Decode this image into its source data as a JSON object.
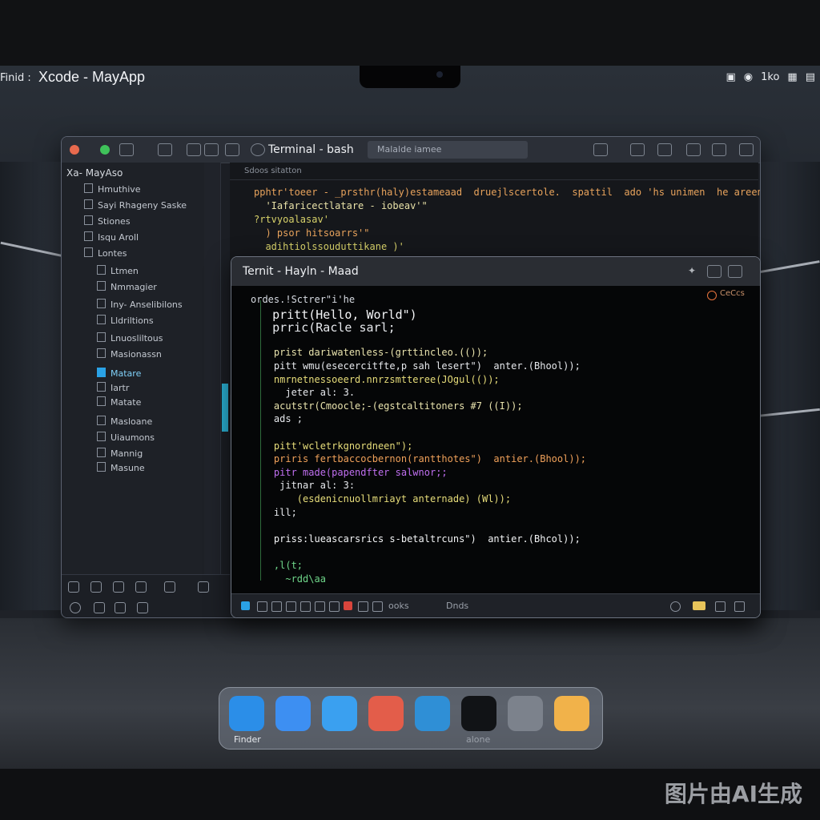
{
  "menubar": {
    "left_label": "Finid :",
    "app_title": "Xcode - MayApp",
    "right_status": "1ko"
  },
  "xcode_window": {
    "terminal_title": "Terminal - bash",
    "tab_placeholder": "Malalde iamee",
    "sidebar_header": "Xa- MayAso",
    "sidebar_items": [
      {
        "label": "Hmuthive",
        "selected": false
      },
      {
        "label": "Sayi Rhageny Saske",
        "selected": false
      },
      {
        "label": "Stiones",
        "selected": false
      },
      {
        "label": "Isqu Aroll",
        "selected": false
      },
      {
        "label": "Lontes",
        "selected": false
      },
      {
        "label": "Ltmen",
        "selected": false
      },
      {
        "label": "Nmmagier",
        "selected": false
      },
      {
        "label": "Iny- Anselibilons",
        "selected": false
      },
      {
        "label": "Lldriltions",
        "selected": false
      },
      {
        "label": "Lnuosliltous",
        "selected": false
      },
      {
        "label": "Masionassn",
        "selected": false
      },
      {
        "label": "Matare",
        "selected": true
      },
      {
        "label": "Iartr",
        "selected": false
      },
      {
        "label": "Matate",
        "selected": false
      },
      {
        "label": "Masloane",
        "selected": false
      },
      {
        "label": "Uiaumons",
        "selected": false
      },
      {
        "label": "Mannig",
        "selected": false
      },
      {
        "label": "Masune",
        "selected": false
      }
    ],
    "bg_toolbar": "Sdoos sitatton",
    "bg_code": [
      {
        "text": "pphtr'toeer - _prsthr(haly)estameaad  druejlscertole.  spattil  ado 'hs unimen  he areen)",
        "color": "#e8a35c"
      },
      {
        "text": "  'Iafaricectlatare - iobeav'\"",
        "color": "#e9e2a8"
      },
      {
        "text": "?rtvyoalasav'",
        "color": "#d8d26a"
      },
      {
        "text": "  ) psor hitsoarrs'\"",
        "color": "#e8a35c"
      },
      {
        "text": "  adihtiolssouduttikane )'",
        "color": "#d8d26a"
      }
    ]
  },
  "terminal_window": {
    "title": "Ternit - Hayln - Maad",
    "badge": "CeCcs",
    "code": [
      {
        "text": "ordes.!Sctrer\"i'he",
        "color": "#d7dbe2"
      },
      {
        "text": "   pritt(Hello, World\")",
        "color": "#f3f4f6"
      },
      {
        "text": "   prric(Racle sarl;",
        "color": "#e6e8ec"
      },
      {
        "text": "",
        "color": "#d7dbe2"
      },
      {
        "text": "    prist dariwatenless-(grttincleo.(());",
        "color": "#e9e3ad"
      },
      {
        "text": "    pitt wmu(esecercitfte,p sah lesert\")  anter.(Bhool));",
        "color": "#e6e8ec"
      },
      {
        "text": "    nmrnetnessoeerd.nnrzsmtteree(JOgul(());",
        "color": "#e7dd7a"
      },
      {
        "text": "      jeter al: 3.",
        "color": "#e6e8ec"
      },
      {
        "text": "    acutstr(Cmoocle;-(egstcaltitoners #7 ((I));",
        "color": "#e9e3ad"
      },
      {
        "text": "    ads ;",
        "color": "#e6e8ec"
      },
      {
        "text": "",
        "color": "#d7dbe2"
      },
      {
        "text": "    pitt'wcletrkgnordneen\");",
        "color": "#e7dd7a"
      },
      {
        "text": "    priris fertbaccocbernon(rantthotes\")  antier.(Bhool));",
        "color": "#f0a15a"
      },
      {
        "text": "    pitr made(papendfter salwnor;;",
        "color": "#c06ff0"
      },
      {
        "text": "     jitnar al: 3:",
        "color": "#e6e8ec"
      },
      {
        "text": "        (esdenicnuollmriayt anternade) (Wl));",
        "color": "#e7dd7a"
      },
      {
        "text": "    ill;",
        "color": "#e6e8ec"
      },
      {
        "text": "",
        "color": "#d7dbe2"
      },
      {
        "text": "    priss:lueascarsrics s-betaltrcuns\")  antier.(Bhcol));",
        "color": "#f3f4f6"
      },
      {
        "text": "",
        "color": "#d7dbe2"
      },
      {
        "text": "    ,l(t;",
        "color": "#6fd68a"
      },
      {
        "text": "      ~rdd\\aa",
        "color": "#6fd68a"
      }
    ],
    "status_label": "ooks",
    "status_label_2": "Dnds"
  },
  "dock": {
    "apps": [
      {
        "name": "finder",
        "label": "Finder",
        "color": "#2b8ee8"
      },
      {
        "name": "safari",
        "label": "",
        "color": "#3d8ff2"
      },
      {
        "name": "safari-2",
        "label": "",
        "color": "#3aa0f0"
      },
      {
        "name": "photos",
        "label": "",
        "color": "#e35d4a"
      },
      {
        "name": "preview",
        "label": "",
        "color": "#2f8fd6"
      },
      {
        "name": "terminal",
        "label": "alone",
        "color": "#111316"
      },
      {
        "name": "system-preferences",
        "label": "",
        "color": "#7c828c"
      },
      {
        "name": "notes",
        "label": "",
        "color": "#f1b24a"
      }
    ]
  },
  "watermark": "图片由AI生成"
}
